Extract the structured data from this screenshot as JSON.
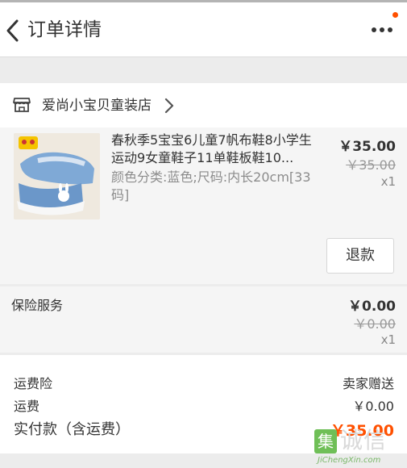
{
  "header": {
    "title": "订单详情"
  },
  "shop": {
    "name": "爱尚小宝贝童装店"
  },
  "item": {
    "title": "春秋季5宝宝6儿童7帆布鞋8小学生运动9女童鞋子11单鞋板鞋10...",
    "sku": "颜色分类:蓝色;尺码:内长20cm[33码]",
    "price": "￥35.00",
    "original_price": "￥35.00",
    "quantity": "x1",
    "refund_label": "退款"
  },
  "insurance": {
    "label": "保险服务",
    "price": "￥0.00",
    "original_price": "￥0.00",
    "quantity": "x1"
  },
  "summary": {
    "shipping_insurance_label": "运费险",
    "shipping_insurance_value": "卖家赠送",
    "shipping_fee_label": "运费",
    "shipping_fee_value": "￥0.00",
    "total_label": "实付款（含运费）",
    "total_value": "￥35.00"
  },
  "watermark": {
    "char": "集",
    "text": "诚信",
    "url": "JiChengXin.com"
  },
  "colors": {
    "accent": "#ff5000",
    "watermark_green": "#6fbf57"
  },
  "icons": [
    "back-icon",
    "more-icon",
    "shop-icon",
    "chevron-right-icon"
  ]
}
